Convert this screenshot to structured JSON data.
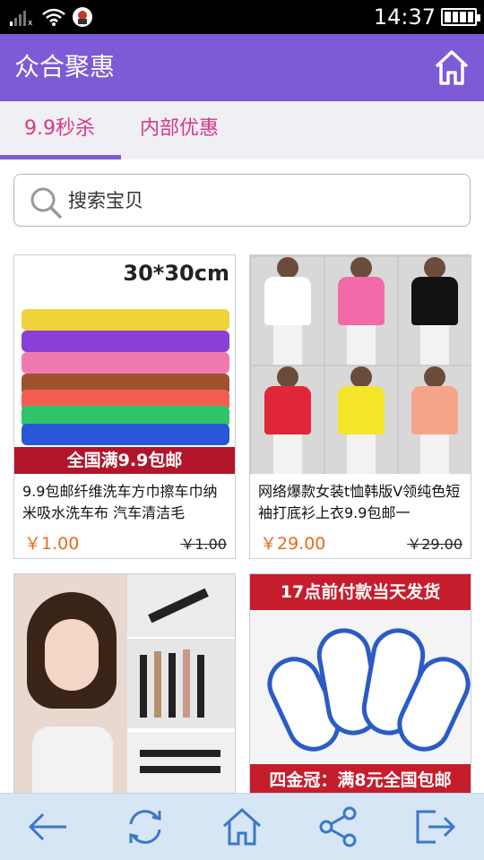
{
  "status_bar": {
    "time": "14:37"
  },
  "header": {
    "title": "众合聚惠"
  },
  "tabs": [
    {
      "label": "9.9秒杀",
      "active": true
    },
    {
      "label": "内部优惠",
      "active": false
    }
  ],
  "search": {
    "placeholder": "搜索宝贝"
  },
  "products": [
    {
      "title": "9.9包邮纤维洗车方巾擦车巾纳米吸水洗车布 汽车清洁毛",
      "price": "￥1.00",
      "original_price": "￥1.00",
      "image_text_top": "30*30cm",
      "image_text_bottom": "全国满9.9包邮"
    },
    {
      "title": "网络爆款女装t恤韩版V领纯色短袖打底衫上衣9.9包邮一",
      "price": "￥29.00",
      "original_price": "￥29.00"
    },
    {
      "title": "",
      "price": "",
      "original_price": ""
    },
    {
      "title": "",
      "price": "",
      "original_price": "",
      "image_text_top": "17点前付款当天发货",
      "image_text_bottom": "四金冠：满8元全国包邮"
    }
  ],
  "colors": {
    "accent": "#7d5ad6",
    "tab_text": "#d63a86",
    "price": "#e86a1c",
    "nav_bg": "#d7e6f4",
    "icon": "#3b78c8"
  },
  "bottom_nav_icons": [
    "back-arrow-icon",
    "refresh-icon",
    "home-icon",
    "share-icon",
    "exit-icon"
  ]
}
